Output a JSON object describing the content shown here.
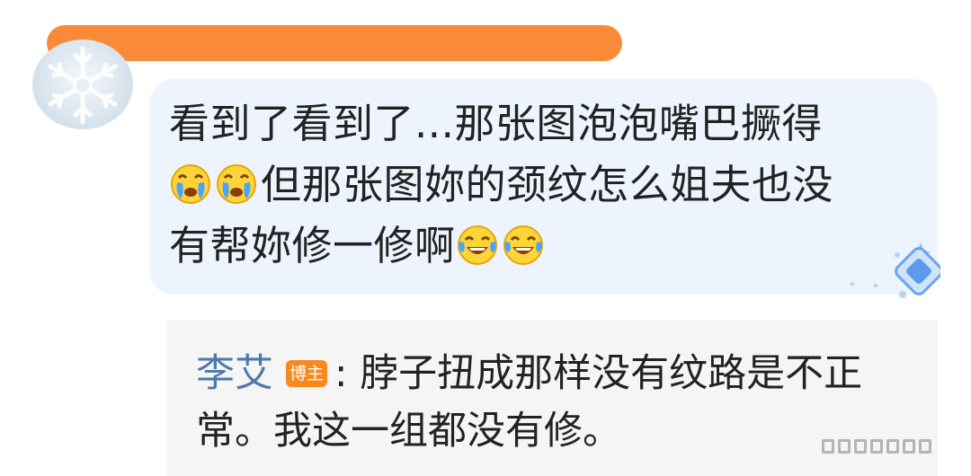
{
  "comment": {
    "line1": "看到了看到了...那张图泡泡嘴巴撅得",
    "line2": "但那张图妳的颈纹怎么姐夫也没",
    "line3": "有帮妳修一修啊",
    "emoji_before_line2": [
      "crying-face-icon",
      "crying-face-icon"
    ],
    "emoji_after_line3": [
      "tears-of-joy-icon",
      "tears-of-joy-icon"
    ],
    "bubble_color": "#edf4fd",
    "text_color": "#222222"
  },
  "username_redaction_color": "#fb8a38",
  "reply": {
    "author": "李艾",
    "author_badge": "博主",
    "separator": ":",
    "text_line1": "脖子扭成那样没有纹路是不正",
    "text_line2": "常。我这一组都没有修。",
    "author_color": "#4f79a8",
    "badge_color": "#f7891e",
    "background": "#f5f5f5"
  }
}
